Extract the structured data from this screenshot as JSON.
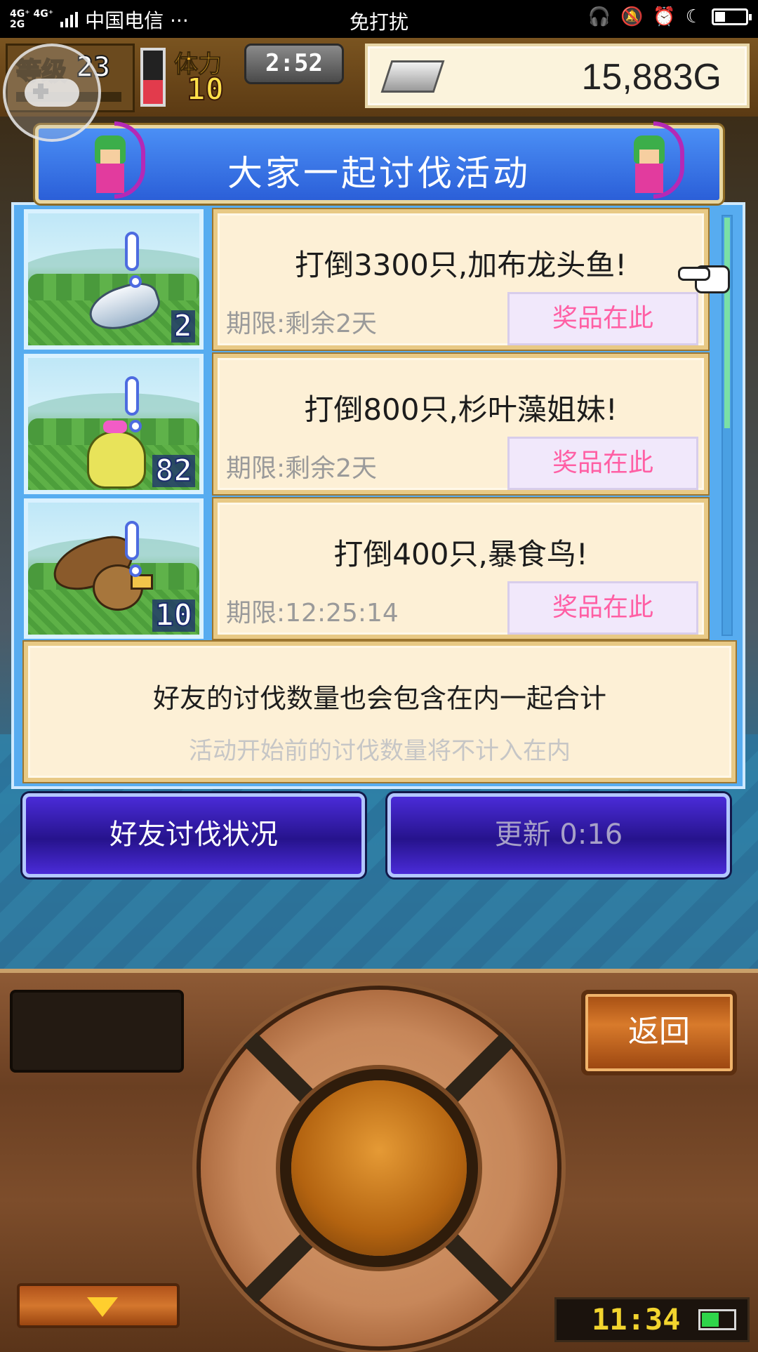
{
  "status_bar": {
    "network_top": "4G⁺ 4G⁺",
    "network_bottom": "2G",
    "carrier": "中国电信 ···",
    "mode": "免打扰"
  },
  "hud": {
    "level_label": "等级",
    "level": "23",
    "stamina_label": "体力",
    "stamina": "10",
    "stamina_fill_fraction": 0.45,
    "timer": "2:52",
    "gold": "15,883G"
  },
  "banner": {
    "title": "大家一起讨伐活动"
  },
  "quests": [
    {
      "title": "打倒3300只,加布龙头鱼!",
      "deadline": "期限:剩余2天",
      "prize_label": "奖品在此",
      "count": "2",
      "monster": "fish"
    },
    {
      "title": "打倒800只,杉叶藻姐妹!",
      "deadline": "期限:剩余2天",
      "prize_label": "奖品在此",
      "count": "82",
      "monster": "slime"
    },
    {
      "title": "打倒400只,暴食鸟!",
      "deadline": "期限:12:25:14",
      "prize_label": "奖品在此",
      "count": "10",
      "monster": "bird"
    }
  ],
  "note": {
    "line1": "好友的讨伐数量也会包含在内一起合计",
    "line2": "活动开始前的讨伐数量将不计入在内"
  },
  "buttons": {
    "friends": "好友讨伐状况",
    "refresh": "更新 0:16",
    "back": "返回"
  },
  "device_clock": "11:34",
  "colors": {
    "panel_blue": "#57acf0",
    "banner_blue": "#2b5fd8",
    "prize_pink": "#ff5fa4",
    "button_purple": "#26138c"
  }
}
